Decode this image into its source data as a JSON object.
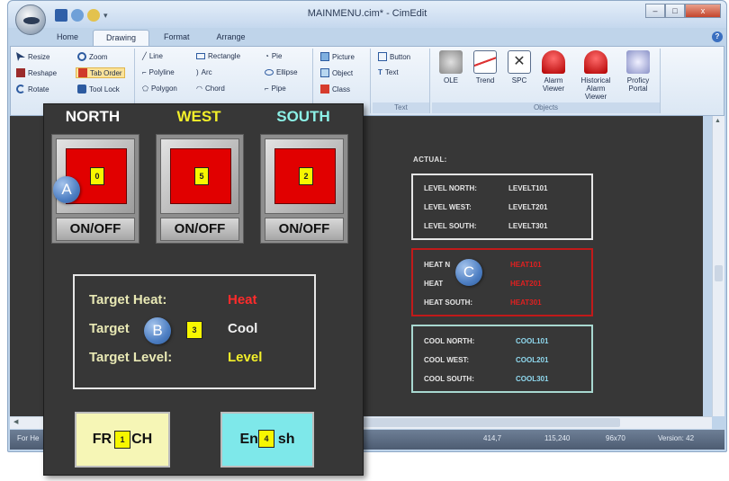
{
  "window": {
    "title": "MAINMENU.cim* - CimEdit",
    "controls": [
      "–",
      "□",
      "x"
    ]
  },
  "ribbon": {
    "tabs": [
      {
        "label": "Home"
      },
      {
        "label": "Drawing",
        "active": true
      },
      {
        "label": "Format"
      },
      {
        "label": "Arrange"
      }
    ],
    "edit_items": [
      "Resize",
      "Zoom",
      "Reshape",
      "Tab Order",
      "Rotate",
      "Tool Lock"
    ],
    "shape_items": [
      "Line",
      "Rectangle",
      "Pie",
      "Polyline",
      "Arc",
      "Ellipse",
      "Polygon",
      "Chord",
      "Pipe"
    ],
    "insert_items": [
      "Picture",
      "Object",
      "Class"
    ],
    "text_items": [
      "Button",
      "Text"
    ],
    "text_group_label": "Text",
    "objects_group_label": "Objects",
    "objects": [
      {
        "label": "OLE",
        "icon": "ole-icon"
      },
      {
        "label": "Trend",
        "icon": "trend-icon"
      },
      {
        "label": "SPC",
        "icon": "spc-icon"
      },
      {
        "label": "Alarm Viewer",
        "icon": "alarm-viewer-icon"
      },
      {
        "label": "Historical Alarm Viewer",
        "icon": "historical-alarm-icon"
      },
      {
        "label": "Proficy Portal",
        "icon": "proficy-portal-icon"
      }
    ]
  },
  "status_bar": {
    "left": "For He",
    "pos": "414,7",
    "coords": "115,240",
    "size": "96x70",
    "version": "Version: 42"
  },
  "indicators": {
    "actual_label": "ACTUAL:",
    "level": [
      {
        "name": "LEVEL NORTH:",
        "value": "LEVELT101"
      },
      {
        "name": "LEVEL WEST:",
        "value": "LEVELT201"
      },
      {
        "name": "LEVEL SOUTH:",
        "value": "LEVELT301"
      }
    ],
    "heat": [
      {
        "name": "HEAT N",
        "value": "HEAT101"
      },
      {
        "name": "HEAT",
        "value": "HEAT201"
      },
      {
        "name": "HEAT SOUTH:",
        "value": "HEAT301"
      }
    ],
    "cool": [
      {
        "name": "COOL NORTH:",
        "value": "COOL101"
      },
      {
        "name": "COOL WEST:",
        "value": "COOL201"
      },
      {
        "name": "COOL SOUTH:",
        "value": "COOL301"
      }
    ]
  },
  "panel": {
    "switches": [
      {
        "direction": "NORTH",
        "color": "#ffffff",
        "tab_order": "0",
        "button": "ON/OFF"
      },
      {
        "direction": "WEST",
        "color": "#f2ef2a",
        "tab_order": "5",
        "button": "ON/OFF"
      },
      {
        "direction": "SOUTH",
        "color": "#8cf0e6",
        "tab_order": "2",
        "button": "ON/OFF"
      }
    ],
    "targets": [
      {
        "label": "Target Heat:",
        "value": "Heat",
        "color": "#ff2b2b"
      },
      {
        "label": "Target",
        "value": "Cool",
        "color": "#f0f0f0"
      },
      {
        "label": "Target Level:",
        "value": "Level",
        "color": "#f2ef2a"
      }
    ],
    "target_tab_order": "3",
    "french": {
      "left": "FR",
      "right": "CH",
      "tab_order": "1"
    },
    "english": {
      "left": "En",
      "right": "sh",
      "tab_order": "4"
    }
  },
  "callouts": [
    "A",
    "B",
    "C"
  ],
  "colors": {
    "canvas": "#373737",
    "heat_box": "#c11a1a",
    "cool_box": "#a8d8d0",
    "french_button": "#f6f6b6",
    "english_button": "#7ee8ea"
  }
}
